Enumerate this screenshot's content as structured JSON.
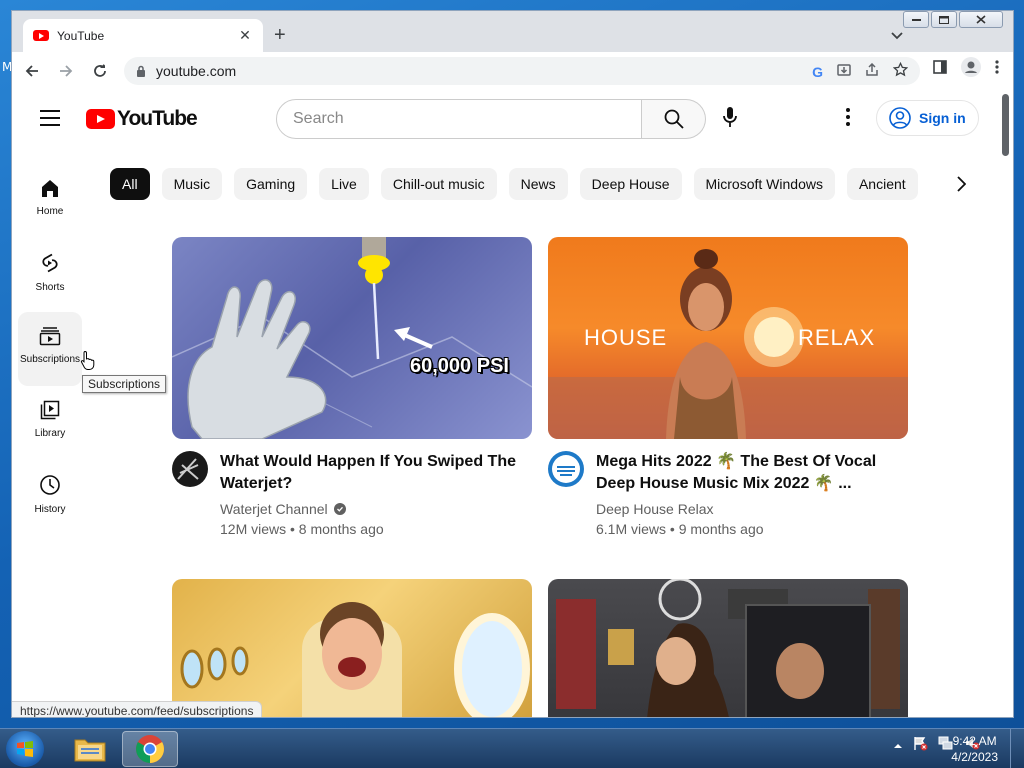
{
  "desktop": {
    "edge_letter": "M"
  },
  "browser": {
    "tab_title": "YouTube",
    "tab_close": "✕",
    "new_tab": "+",
    "url": "youtube.com",
    "status_url": "https://www.youtube.com/feed/subscriptions"
  },
  "youtube": {
    "logo_text": "YouTube",
    "search_placeholder": "Search",
    "sign_in": "Sign in",
    "chips": [
      "All",
      "Music",
      "Gaming",
      "Live",
      "Chill-out music",
      "News",
      "Deep House",
      "Microsoft Windows",
      "Ancient"
    ],
    "sidebar": [
      {
        "label": "Home",
        "icon": "home-icon"
      },
      {
        "label": "Shorts",
        "icon": "shorts-icon"
      },
      {
        "label": "Subscriptions",
        "icon": "subscriptions-icon"
      },
      {
        "label": "Library",
        "icon": "library-icon"
      },
      {
        "label": "History",
        "icon": "history-icon"
      }
    ],
    "tooltip": "Subscriptions",
    "videos": [
      {
        "title": "What Would Happen If You Swiped The Waterjet?",
        "channel": "Waterjet Channel",
        "stats": "12M views • 8 months ago",
        "thumb_text": "60,000 PSI"
      },
      {
        "title": "Mega Hits 2022 🌴 The Best Of Vocal Deep House Music Mix 2022 🌴 ...",
        "channel": "Deep House Relax",
        "stats": "6.1M views • 9 months ago",
        "thumb_text_left": "HOUSE",
        "thumb_text_right": "RELAX"
      }
    ]
  },
  "taskbar": {
    "time": "9:42 AM",
    "date": "4/2/2023"
  },
  "colors": {
    "yt_red": "#ff0000",
    "link_blue": "#065fd4",
    "chip_active": "#0f0f0f"
  }
}
